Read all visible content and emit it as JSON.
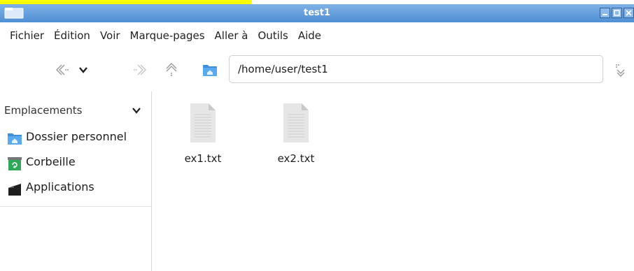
{
  "window": {
    "title": "test1"
  },
  "menu": [
    "Fichier",
    "Édition",
    "Voir",
    "Marque-pages",
    "Aller à",
    "Outils",
    "Aide"
  ],
  "toolbar": {
    "location": "/home/user/test1",
    "icons": [
      "back-icon",
      "history-dropdown-icon",
      "forward-icon",
      "parent-folder-icon",
      "home-icon",
      "location-mode-icon"
    ]
  },
  "sidebar": {
    "header": "Emplacements",
    "items": [
      {
        "label": "Dossier personnel",
        "icon": "home-folder-icon"
      },
      {
        "label": "Corbeille",
        "icon": "trash-icon"
      },
      {
        "label": "Applications",
        "icon": "applications-icon"
      }
    ]
  },
  "files": [
    {
      "name": "ex1.txt",
      "icon": "text-file-icon"
    },
    {
      "name": "ex2.txt",
      "icon": "text-file-icon"
    }
  ],
  "colors": {
    "titlebar": "#5b98da",
    "folder": "#4a9be0",
    "trash": "#2fa85a",
    "highlight": "#ffff00"
  }
}
